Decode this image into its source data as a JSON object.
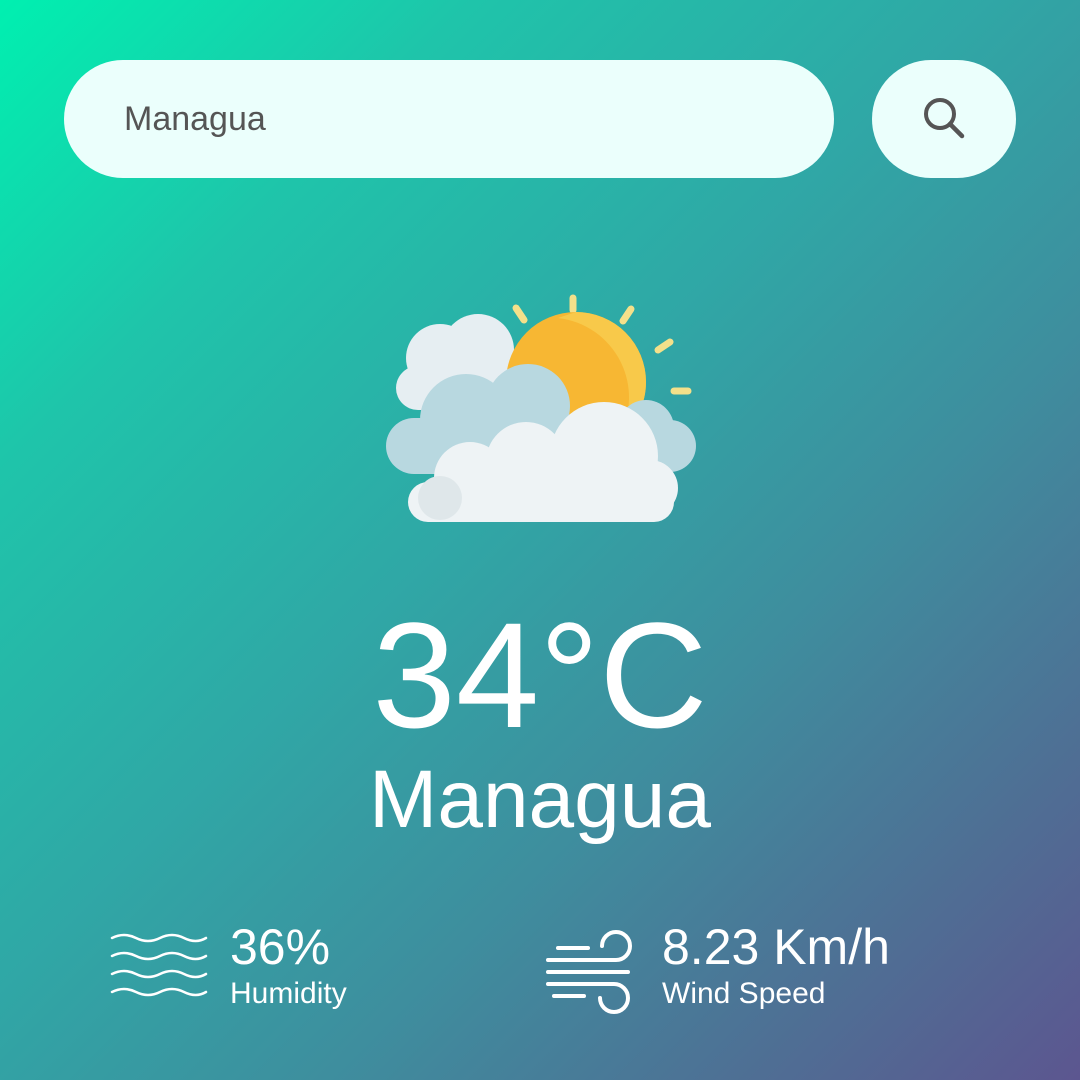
{
  "search": {
    "value": "Managua",
    "button_icon": "search-icon"
  },
  "weather": {
    "icon": "sun-behind-clouds-icon",
    "temperature": "34°C",
    "city": "Managua"
  },
  "humidity": {
    "icon": "humidity-waves-icon",
    "value": "36%",
    "label": "Humidity"
  },
  "wind": {
    "icon": "wind-icon",
    "value": "8.23 Km/h",
    "label": "Wind Speed"
  },
  "colors": {
    "gradient_start": "#00f0b0",
    "gradient_end": "#5c5690",
    "input_background": "#ebfffc",
    "text": "#ffffff",
    "sun": "#f7b733",
    "cloud": "#eef3f5"
  }
}
